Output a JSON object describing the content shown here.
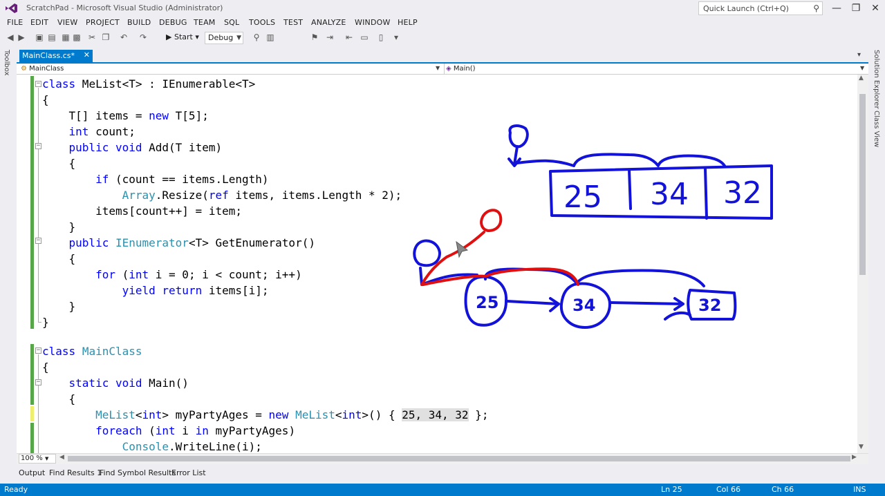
{
  "window": {
    "title": "ScratchPad - Microsoft Visual Studio (Administrator)",
    "quick_launch_placeholder": "Quick Launch (Ctrl+Q)",
    "minimize": "—",
    "restore": "❐",
    "close": "✕"
  },
  "menu": [
    "FILE",
    "EDIT",
    "VIEW",
    "PROJECT",
    "BUILD",
    "DEBUG",
    "TEAM",
    "SQL",
    "TOOLS",
    "TEST",
    "ANALYZE",
    "WINDOW",
    "HELP"
  ],
  "toolbar": {
    "start_label": "▶ Start ▾",
    "configuration": "Debug"
  },
  "side_panels": {
    "left": "Toolbox",
    "right": [
      "Solution Explorer",
      "Class View"
    ]
  },
  "document_tab": {
    "label": "MainClass.cs*",
    "close": "✕"
  },
  "navigation": {
    "class_dropdown": "MainClass",
    "member_dropdown": "Main()"
  },
  "code": [
    [
      "",
      {
        "kw": "class"
      },
      " MeList<T> : IEnumerable<T>"
    ],
    [
      "{"
    ],
    [
      "    T[] items = ",
      {
        "kw": "new"
      },
      " T[5];"
    ],
    [
      "    ",
      {
        "kw": "int"
      },
      " count;"
    ],
    [
      "    ",
      {
        "kw": "public"
      },
      " ",
      {
        "kw": "void"
      },
      " Add(T item)"
    ],
    [
      "    {"
    ],
    [
      "        ",
      {
        "kw": "if"
      },
      " (count == items.Length)"
    ],
    [
      "            ",
      {
        "ty": "Array"
      },
      ".Resize(",
      {
        "kw": "ref"
      },
      " items, items.Length * 2);"
    ],
    [
      "        items[count++] = item;"
    ],
    [
      "    }"
    ],
    [
      "    ",
      {
        "kw": "public"
      },
      " ",
      {
        "ty": "IEnumerator"
      },
      "<T> GetEnumerator()"
    ],
    [
      "    {"
    ],
    [
      "        ",
      {
        "kw": "for"
      },
      " (",
      {
        "kw": "int"
      },
      " i = 0; i < count; i++)"
    ],
    [
      "            ",
      {
        "kw": "yield"
      },
      " ",
      {
        "kw": "return"
      },
      " items[i];"
    ],
    [
      "    }"
    ],
    [
      "}"
    ],
    [
      ""
    ],
    [
      "",
      {
        "kw": "class"
      },
      " ",
      {
        "ty": "MainClass"
      }
    ],
    [
      "{"
    ],
    [
      "    ",
      {
        "kw": "static"
      },
      " ",
      {
        "kw": "void"
      },
      " Main()"
    ],
    [
      "    {"
    ],
    [
      "        ",
      {
        "ty": "MeList"
      },
      "<",
      {
        "kw": "int"
      },
      "> myPartyAges = ",
      {
        "kw": "new"
      },
      " ",
      {
        "ty": "MeList"
      },
      "<",
      {
        "kw": "int"
      },
      ">() { ",
      {
        "hl": "25, 34, 32"
      },
      " };"
    ],
    [
      "        ",
      {
        "kw": "foreach"
      },
      " (",
      {
        "kw": "int"
      },
      " i ",
      {
        "kw": "in"
      },
      " myPartyAges)"
    ],
    [
      "            ",
      {
        "ty": "Console"
      },
      ".WriteLine(i);"
    ]
  ],
  "drawing": {
    "array_values": [
      "25",
      "34",
      "32"
    ],
    "node_values": [
      "25",
      "34",
      "32"
    ],
    "blue_color": "#1212d8",
    "red_color": "#e01010"
  },
  "zoom": "100 %",
  "bottom_tabs": [
    "Output",
    "Find Results 1",
    "Find Symbol Results",
    "Error List"
  ],
  "status": {
    "left": "Ready",
    "line": "Ln 25",
    "col": "Col 66",
    "ch": "Ch 66",
    "mode": "INS"
  }
}
